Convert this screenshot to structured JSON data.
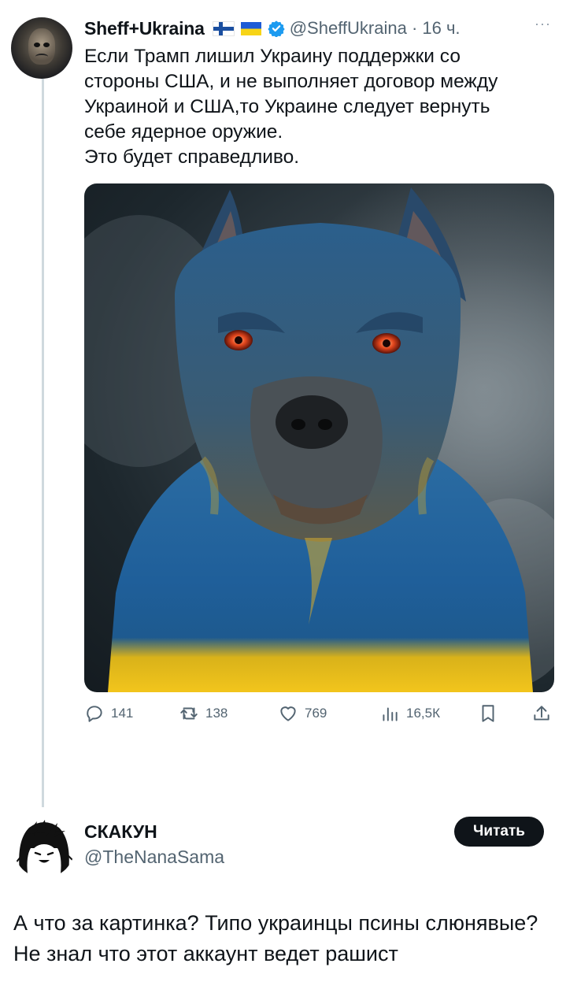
{
  "tweet": {
    "author_name": "Sheff+Ukraina",
    "handle_time": "@SheffUkraina · 16 ч.",
    "more": "···",
    "text": "Если Трамп лишил Украину поддержки со\nстороны США, и не выполняет договор между\nУкраиной и США,то Украине следует вернуть\nсебе ядерное оружие.\n Это будет справедливо.",
    "media": {
      "description_icon": "image-ukraine-flag-dog"
    },
    "stats": {
      "replies": "141",
      "retweets": "138",
      "likes": "769",
      "views": "16,5К"
    },
    "icons": {
      "reply": "reply-icon",
      "retweet": "retweet-icon",
      "like": "heart-icon",
      "views": "views-icon",
      "bookmark": "bookmark-icon",
      "share": "share-icon",
      "verified": "verified-badge-icon",
      "flags": [
        "flag-finland-icon",
        "flag-ukraine-icon"
      ]
    },
    "colors": {
      "verified": "#1d9bf0",
      "ua_blue": "#1d5bd6",
      "ua_yellow": "#f7d417"
    }
  },
  "reply": {
    "author_name": "СКАКУН",
    "handle": "@TheNanaSama",
    "follow_label": "Читать",
    "text": "А что за картинка? Типо украинцы псины слюнявые? Не знал что этот аккаунт ведет рашист"
  }
}
